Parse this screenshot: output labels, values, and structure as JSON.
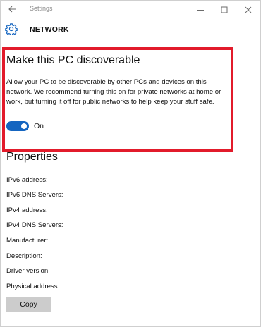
{
  "titlebar": {
    "title": "Settings",
    "back_icon": "back-arrow-icon",
    "minimize_icon": "minimize-icon",
    "maximize_icon": "maximize-icon",
    "close_icon": "close-icon"
  },
  "header": {
    "icon": "gear-icon",
    "title": "NETWORK"
  },
  "discoverable": {
    "title": "Make this PC discoverable",
    "description": "Allow your PC to be discoverable by other PCs and devices on this network. We recommend turning this on for private networks at home or work, but turning it off for public networks to help keep your stuff safe.",
    "toggle_state": "On",
    "toggle_on": true
  },
  "properties": {
    "title": "Properties",
    "rows": [
      "IPv6 address:",
      "IPv6 DNS Servers:",
      "IPv4 address:",
      "IPv4 DNS Servers:",
      "Manufacturer:",
      "Description:",
      "Driver version:",
      "Physical address:"
    ]
  },
  "copy_button": "Copy",
  "colors": {
    "accent": "#1565c0",
    "highlight_border": "#e21b2b",
    "button_bg": "#cccccc",
    "muted_text": "#8a8a8a"
  }
}
